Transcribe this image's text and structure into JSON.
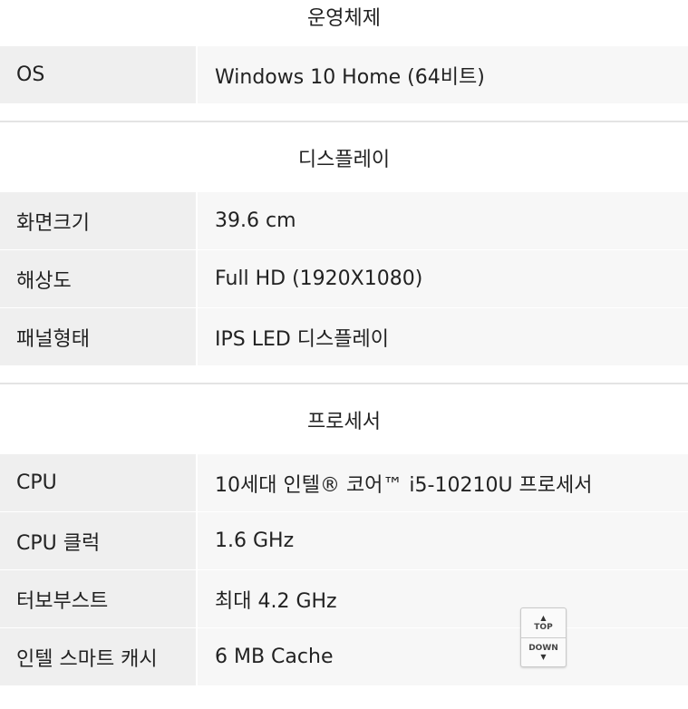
{
  "sections": [
    {
      "title": "운영체제",
      "rows": [
        {
          "label": "OS",
          "value": "Windows 10 Home (64비트)"
        }
      ]
    },
    {
      "title": "디스플레이",
      "rows": [
        {
          "label": "화면크기",
          "value": "39.6 cm"
        },
        {
          "label": "해상도",
          "value": "Full HD (1920X1080)"
        },
        {
          "label": "패널형태",
          "value": "IPS LED 디스플레이"
        }
      ]
    },
    {
      "title": "프로세서",
      "rows": [
        {
          "label": "CPU",
          "value": "10세대 인텔® 코어™ i5-10210U 프로세서"
        },
        {
          "label": "CPU 클럭",
          "value": "1.6 GHz"
        },
        {
          "label": "터보부스트",
          "value": "최대 4.2 GHz"
        },
        {
          "label": "인텔 스마트 캐시",
          "value": "6 MB Cache"
        }
      ]
    }
  ],
  "scroll": {
    "top_label": "TOP",
    "down_label": "DOWN",
    "top_icon": "arrow-up-to-bar",
    "down_icon": "arrow-down-to-bar"
  }
}
